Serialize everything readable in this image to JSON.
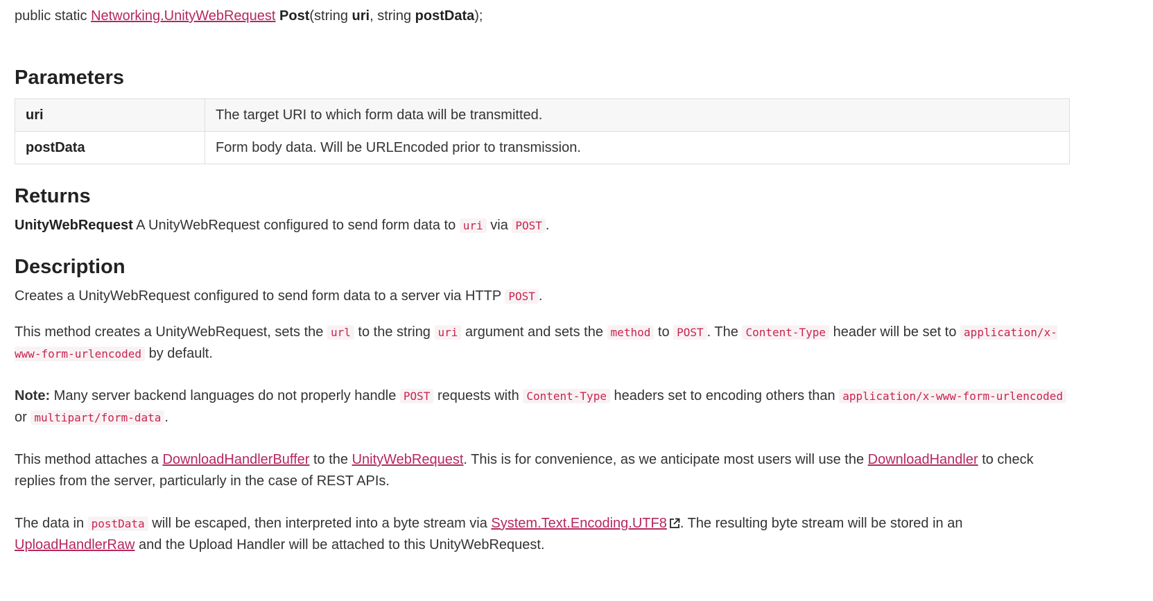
{
  "signature": {
    "prefix": "public static ",
    "return_type": "Networking.UnityWebRequest",
    "method_name": "Post",
    "open_paren": "(string ",
    "param1_name": "uri",
    "separator": ", string ",
    "param2_name": "postData",
    "close": ");"
  },
  "parameters": {
    "heading": "Parameters",
    "rows": [
      {
        "name": "uri",
        "description": "The target URI to which form data will be transmitted."
      },
      {
        "name": "postData",
        "description": "Form body data. Will be URLEncoded prior to transmission."
      }
    ]
  },
  "returns": {
    "heading": "Returns",
    "type": "UnityWebRequest",
    "text_before": " A UnityWebRequest configured to send form data to ",
    "code1": "uri",
    "text_mid": " via ",
    "code2": "POST",
    "text_after": "."
  },
  "description": {
    "heading": "Description",
    "p1": {
      "t1": "Creates a UnityWebRequest configured to send form data to a server via HTTP ",
      "c1": "POST",
      "t2": "."
    },
    "p2": {
      "t1": "This method creates a UnityWebRequest, sets the ",
      "c1": "url",
      "t2": " to the string ",
      "c2": "uri",
      "t3": " argument and sets the ",
      "c3": "method",
      "t4": " to ",
      "c4": "POST",
      "t5": ". The ",
      "c5": "Content-Type",
      "t6": " header will be set to ",
      "c6": "application/x-www-form-urlencoded",
      "t7": " by default."
    },
    "p3": {
      "label": "Note:",
      "t1": " Many server backend languages do not properly handle ",
      "c1": "POST",
      "t2": " requests with ",
      "c2": "Content-Type",
      "t3": " headers set to encoding others than ",
      "c3": "application/x-www-form-urlencoded",
      "t4": " or ",
      "c4": "multipart/form-data",
      "t5": "."
    },
    "p4": {
      "t1": "This method attaches a ",
      "l1": "DownloadHandlerBuffer",
      "t2": " to the ",
      "l2": "UnityWebRequest",
      "t3": ". This is for convenience, as we anticipate most users will use the ",
      "l3": "DownloadHandler",
      "t4": " to check replies from the server, particularly in the case of REST APIs."
    },
    "p5": {
      "t1": "The data in ",
      "c1": "postData",
      "t2": " will be escaped, then interpreted into a byte stream via ",
      "l1": "System.Text.Encoding.UTF8",
      "t3": ". The resulting byte stream will be stored in an ",
      "l2": "UploadHandlerRaw",
      "t4": " and the Upload Handler will be attached to this UnityWebRequest."
    }
  },
  "icons": {
    "external_link": "external-link-icon"
  },
  "colors": {
    "link": "#b5275e",
    "code_text": "#c7254e",
    "code_bg": "#f9f2f4"
  }
}
